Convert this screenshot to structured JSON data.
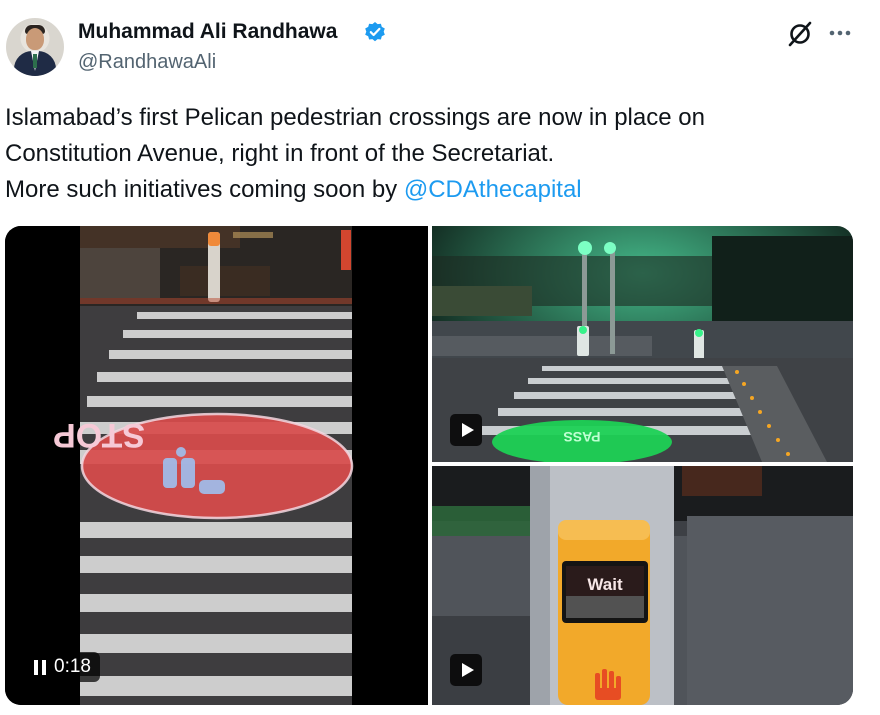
{
  "author": {
    "name": "Muhammad Ali Randhawa",
    "handle": "@RandhawaAli"
  },
  "tweet": {
    "line1": "Islamabad’s first Pelican pedestrian crossings are now in place on",
    "line2": "Constitution Avenue, right in front of the Secretariat.",
    "line3_prefix": "More such initiatives coming soon by ",
    "mention": "@CDAthecapital"
  },
  "media": {
    "video1": {
      "duration": "0:18",
      "projection_text": "STOP"
    },
    "video2": {
      "projection_text": "PASS"
    },
    "image3": {
      "sign_text": "Wait"
    }
  },
  "icons": {
    "verified": "verified-badge-icon",
    "grok": "grok-icon",
    "more": "more-options-icon",
    "pause": "pause-icon",
    "play": "play-icon"
  },
  "colors": {
    "verified": "#1d9bf0",
    "mention": "#1d9bf0",
    "handle": "#536471",
    "text": "#0f1419"
  }
}
